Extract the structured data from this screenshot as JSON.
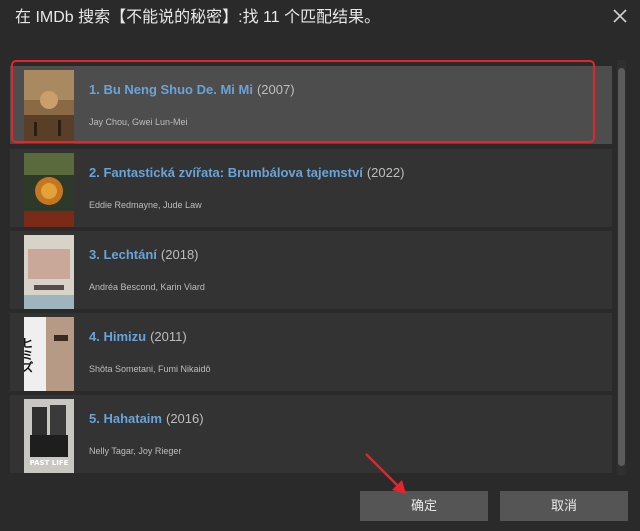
{
  "dialog": {
    "title": "在 IMDb 搜索【不能说的秘密】:找 11 个匹配结果。"
  },
  "results": [
    {
      "name": "1. Bu Neng Shuo De. Mi Mi",
      "year": "(2007)",
      "cast": "Jay Chou, Gwei Lun-Mei",
      "selected": true
    },
    {
      "name": "2. Fantastická zvířata: Brumbálova tajemství",
      "year": "(2022)",
      "cast": "Eddie Redmayne, Jude Law",
      "selected": false
    },
    {
      "name": "3. Lechtání",
      "year": "(2018)",
      "cast": "Andréa Bescond, Karin Viard",
      "selected": false
    },
    {
      "name": "4. Himizu",
      "year": "(2011)",
      "cast": "Shôta Sometani, Fumi Nikaidô",
      "selected": false
    },
    {
      "name": "5. Hahataim",
      "year": "(2016)",
      "cast": "Nelly Tagar, Joy Rieger",
      "selected": false
    }
  ],
  "posters": [
    {
      "title_text": ""
    },
    {
      "title_text": ""
    },
    {
      "title_text": ""
    },
    {
      "title_text": "ヒミズ"
    },
    {
      "title_text": "PAST LIFE"
    }
  ],
  "buttons": {
    "ok_label": "确定",
    "cancel_label": "取消"
  },
  "colors": {
    "link": "#6aa3d8",
    "highlight": "#e5242c",
    "background": "#2a2a2a"
  }
}
